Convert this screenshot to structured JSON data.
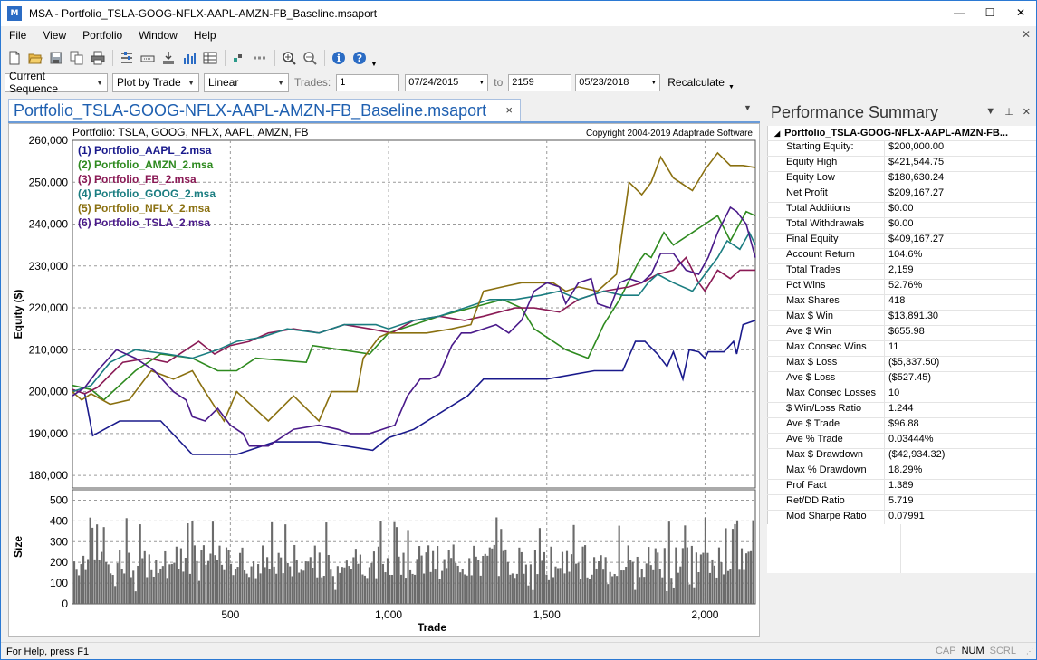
{
  "window": {
    "title": "MSA - Portfolio_TSLA-GOOG-NFLX-AAPL-AMZN-FB_Baseline.msaport",
    "app_icon_text": "M",
    "minimize": "—",
    "maximize": "☐",
    "close": "✕"
  },
  "menu": [
    "File",
    "View",
    "Portfolio",
    "Window",
    "Help"
  ],
  "menu_close": "✕",
  "toolbar1_icons": [
    "new-icon",
    "open-icon",
    "save-icon",
    "copy-icon",
    "print-icon",
    "|",
    "equity-layout-icon",
    "import-icon",
    "download-icon",
    "bar-chart-icon",
    "table-icon",
    "|",
    "grid-dots-icon",
    "dashes-icon",
    "|",
    "zoom-in-icon",
    "zoom-out-icon",
    "|",
    "info-icon",
    "help-icon",
    "dropdown-arrow-icon"
  ],
  "toolbar2": {
    "sequence": "Current Sequence",
    "plot_by": "Plot by Trade",
    "scale": "Linear",
    "trades_label": "Trades:",
    "trades_from": "1",
    "date_from": "07/24/2015",
    "to_label": "to",
    "trades_to": "2159",
    "date_to": "05/23/2018",
    "recalculate": "Recalculate"
  },
  "document_tab": {
    "label": "Portfolio_TSLA-GOOG-NFLX-AAPL-AMZN-FB_Baseline.msaport",
    "close": "×"
  },
  "chart_header": {
    "portfolio": "Portfolio: TSLA, GOOG, NFLX, AAPL, AMZN, FB",
    "copyright": "Copyright 2004-2019 Adaptrade Software"
  },
  "chart_data": {
    "type": "line",
    "title": "Portfolio: TSLA, GOOG, NFLX, AAPL, AMZN, FB",
    "xlabel": "Trade",
    "ylabel": "Equity ($)",
    "xlim": [
      1,
      2159
    ],
    "ylim": [
      177000,
      260000
    ],
    "x_ticks": [
      500,
      1000,
      1500,
      2000
    ],
    "x_tick_labels": [
      "500",
      "1,000",
      "1,500",
      "2,000"
    ],
    "y_ticks": [
      180000,
      190000,
      200000,
      210000,
      220000,
      230000,
      240000,
      250000,
      260000
    ],
    "y_tick_labels": [
      "180,000",
      "190,000",
      "200,000",
      "210,000",
      "220,000",
      "230,000",
      "240,000",
      "250,000",
      "260,000"
    ],
    "grid": true,
    "legend_position": "top-left",
    "series": [
      {
        "name": "(1) Portfolio_AAPL_2.msa",
        "color": "#1a1a8c",
        "x": [
          1,
          40,
          65,
          150,
          280,
          380,
          520,
          560,
          640,
          780,
          950,
          1000,
          1080,
          1250,
          1300,
          1500,
          1650,
          1740,
          1780,
          1810,
          1850,
          1880,
          1900,
          1930,
          1950,
          1980,
          2000,
          2010,
          2060,
          2090,
          2100,
          2120,
          2159
        ],
        "y": [
          200500,
          199500,
          189500,
          193000,
          193000,
          185000,
          185000,
          186000,
          188000,
          188000,
          186000,
          189000,
          191000,
          199000,
          203000,
          203000,
          205000,
          205000,
          212000,
          212000,
          209000,
          206000,
          209500,
          203000,
          210000,
          209500,
          208000,
          209500,
          209500,
          212000,
          209000,
          216000,
          217000
        ]
      },
      {
        "name": "(2) Portfolio_AMZN_2.msa",
        "color": "#2e8a1f",
        "x": [
          1,
          60,
          100,
          200,
          280,
          380,
          460,
          520,
          580,
          740,
          760,
          940,
          1000,
          1080,
          1160,
          1260,
          1360,
          1420,
          1460,
          1560,
          1630,
          1680,
          1730,
          1790,
          1810,
          1830,
          1870,
          1900,
          1960,
          2000,
          2040,
          2080,
          2130,
          2159
        ],
        "y": [
          201500,
          200500,
          198000,
          205000,
          209000,
          208000,
          205000,
          205000,
          208000,
          207000,
          211000,
          209000,
          214000,
          216000,
          218000,
          220000,
          222000,
          220000,
          215000,
          210000,
          208000,
          216000,
          222000,
          231000,
          233000,
          232000,
          238000,
          235000,
          238000,
          240000,
          242000,
          236000,
          243000,
          242000
        ]
      },
      {
        "name": "(3) Portfolio_FB_2.msa",
        "color": "#8a1a55",
        "x": [
          1,
          40,
          80,
          120,
          160,
          240,
          300,
          360,
          400,
          450,
          500,
          560,
          620,
          700,
          780,
          860,
          940,
          1010,
          1080,
          1160,
          1240,
          1300,
          1400,
          1460,
          1540,
          1600,
          1680,
          1760,
          1800,
          1850,
          1900,
          1940,
          1980,
          2000,
          2040,
          2080,
          2110,
          2159
        ],
        "y": [
          200500,
          199500,
          201000,
          204000,
          207000,
          208000,
          207000,
          210000,
          212000,
          209000,
          211000,
          212000,
          214000,
          215000,
          214000,
          216000,
          215000,
          214000,
          217000,
          218000,
          217000,
          218000,
          220000,
          220000,
          219000,
          222000,
          224000,
          225000,
          226000,
          228000,
          229000,
          232000,
          226000,
          224000,
          229000,
          227000,
          229000,
          229000
        ]
      },
      {
        "name": "(4) Portfolio_GOOG_2.msa",
        "color": "#1a7d80",
        "x": [
          1,
          60,
          120,
          200,
          300,
          380,
          460,
          520,
          600,
          680,
          780,
          860,
          960,
          1000,
          1080,
          1160,
          1240,
          1320,
          1400,
          1480,
          1540,
          1600,
          1680,
          1740,
          1790,
          1820,
          1850,
          1900,
          1960,
          2000,
          2040,
          2070,
          2110,
          2140,
          2159
        ],
        "y": [
          200000,
          201500,
          207000,
          210000,
          209000,
          208000,
          210000,
          212000,
          213000,
          215000,
          214000,
          216000,
          216000,
          215000,
          217000,
          218000,
          220000,
          222000,
          222000,
          223000,
          224000,
          222000,
          224000,
          223000,
          223000,
          226000,
          228000,
          226000,
          224000,
          228000,
          232000,
          236000,
          234000,
          238000,
          235000
        ]
      },
      {
        "name": "(5) Portfolio_NFLX_2.msa",
        "color": "#8a7010",
        "x": [
          1,
          30,
          60,
          120,
          180,
          250,
          320,
          380,
          420,
          480,
          520,
          620,
          700,
          780,
          820,
          900,
          920,
          970,
          1000,
          1060,
          1120,
          1200,
          1260,
          1300,
          1360,
          1420,
          1480,
          1520,
          1560,
          1600,
          1660,
          1720,
          1760,
          1800,
          1830,
          1860,
          1900,
          1960,
          2000,
          2040,
          2080,
          2120,
          2159
        ],
        "y": [
          200000,
          198000,
          199500,
          197000,
          198000,
          205000,
          203000,
          205000,
          200000,
          193000,
          200000,
          193000,
          199000,
          193000,
          200000,
          200000,
          208000,
          213000,
          214000,
          214000,
          214000,
          215000,
          216000,
          224000,
          225000,
          226000,
          226000,
          226000,
          224000,
          225000,
          224000,
          228000,
          250000,
          247000,
          250000,
          256000,
          251000,
          248000,
          253000,
          257000,
          254000,
          254000,
          253500
        ]
      },
      {
        "name": "(6) Portfolio_TSLA_2.msa",
        "color": "#4a1a8a",
        "x": [
          1,
          40,
          80,
          140,
          200,
          260,
          320,
          360,
          380,
          420,
          460,
          500,
          540,
          560,
          620,
          700,
          780,
          840,
          880,
          940,
          980,
          1020,
          1060,
          1100,
          1130,
          1160,
          1200,
          1230,
          1260,
          1300,
          1340,
          1380,
          1420,
          1460,
          1500,
          1540,
          1560,
          1600,
          1640,
          1660,
          1700,
          1730,
          1760,
          1800,
          1830,
          1860,
          1900,
          1940,
          1980,
          2010,
          2040,
          2080,
          2100,
          2130,
          2159
        ],
        "y": [
          199000,
          201000,
          205000,
          210000,
          208000,
          205000,
          200000,
          198000,
          194000,
          193000,
          196000,
          192000,
          190000,
          187000,
          187000,
          191000,
          192000,
          191000,
          190000,
          190000,
          191000,
          192000,
          199000,
          203000,
          203000,
          204000,
          211000,
          214000,
          214000,
          215000,
          216000,
          214000,
          217000,
          224000,
          226000,
          225000,
          221000,
          226000,
          227000,
          221000,
          220000,
          226000,
          227000,
          226000,
          228000,
          233000,
          233000,
          229000,
          228000,
          232000,
          238000,
          244000,
          243000,
          240000,
          232000
        ]
      }
    ]
  },
  "size_panel": {
    "ylabel": "Size",
    "y_ticks": [
      0,
      100,
      200,
      300,
      400,
      500
    ],
    "y_tick_labels": [
      "0",
      "100",
      "200",
      "300",
      "400",
      "500"
    ],
    "ylim": [
      0,
      550
    ],
    "max": 418,
    "typical": 250
  },
  "performance": {
    "title": "Performance Summary",
    "panel_icons": [
      "dropdown-icon",
      "pin-icon",
      "close-icon"
    ],
    "group": "Portfolio_TSLA-GOOG-NFLX-AAPL-AMZN-FB...",
    "rows": [
      {
        "k": "Starting Equity:",
        "v": "$200,000.00"
      },
      {
        "k": "Equity High",
        "v": "$421,544.75"
      },
      {
        "k": "Equity Low",
        "v": "$180,630.24"
      },
      {
        "k": "Net Profit",
        "v": "$209,167.27"
      },
      {
        "k": "Total Additions",
        "v": "$0.00"
      },
      {
        "k": "Total Withdrawals",
        "v": "$0.00"
      },
      {
        "k": "Final Equity",
        "v": "$409,167.27"
      },
      {
        "k": "Account Return",
        "v": "104.6%"
      },
      {
        "k": "Total Trades",
        "v": "2,159"
      },
      {
        "k": "Pct Wins",
        "v": "52.76%"
      },
      {
        "k": "Max Shares",
        "v": "418"
      },
      {
        "k": "Max $ Win",
        "v": "$13,891.30"
      },
      {
        "k": "Ave $ Win",
        "v": "$655.98"
      },
      {
        "k": "Max Consec Wins",
        "v": "11"
      },
      {
        "k": "Max $ Loss",
        "v": "($5,337.50)"
      },
      {
        "k": "Ave $ Loss",
        "v": "($527.45)"
      },
      {
        "k": "Max Consec Losses",
        "v": "10"
      },
      {
        "k": "$ Win/Loss Ratio",
        "v": "1.244"
      },
      {
        "k": "Ave $ Trade",
        "v": "$96.88"
      },
      {
        "k": "Ave % Trade",
        "v": "0.03444%"
      },
      {
        "k": "Max $ Drawdown",
        "v": "($42,934.32)"
      },
      {
        "k": "Max % Drawdown",
        "v": "18.29%"
      },
      {
        "k": "Prof Fact",
        "v": "1.389"
      },
      {
        "k": "Ret/DD Ratio",
        "v": "5.719"
      },
      {
        "k": "Mod Sharpe Ratio",
        "v": "0.07991"
      }
    ]
  },
  "status": {
    "text": "For Help, press F1",
    "cap": "CAP",
    "num": "NUM",
    "scrl": "SCRL"
  }
}
